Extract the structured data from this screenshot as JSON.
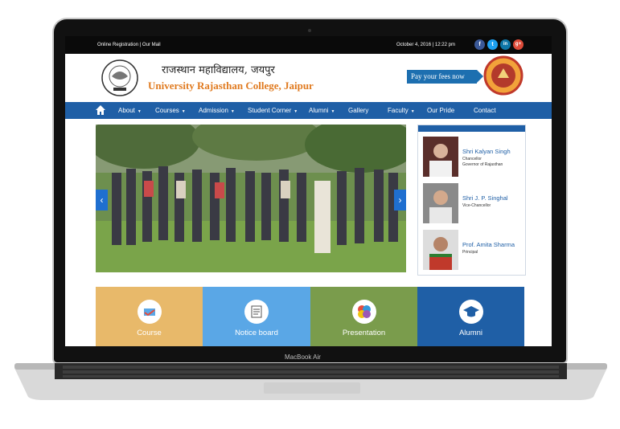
{
  "topbar": {
    "links": "Online Registration | Our Mail",
    "datetime": "October 4, 2016 | 12:22 pm",
    "social": [
      {
        "icon": "facebook-icon",
        "glyph": "f",
        "color": "#3b5998"
      },
      {
        "icon": "twitter-icon",
        "glyph": "t",
        "color": "#1da1f2"
      },
      {
        "icon": "linkedin-icon",
        "glyph": "in",
        "color": "#0e76a8"
      },
      {
        "icon": "google-plus-icon",
        "glyph": "g+",
        "color": "#dd4b39"
      }
    ]
  },
  "header": {
    "hindi_title": "राजस्थान महाविद्यालय, जयपुर",
    "english_title": "University Rajasthan College, Jaipur",
    "pay_fees": "Pay your fees now",
    "seal_text": "Established - 1957",
    "seal_motto": "कर्मो मे कौशलम"
  },
  "nav": {
    "items": [
      {
        "label": "About",
        "dropdown": true
      },
      {
        "label": "Courses",
        "dropdown": true
      },
      {
        "label": "Admission",
        "dropdown": true
      },
      {
        "label": "Student Corner",
        "dropdown": true
      },
      {
        "label": "Alumni",
        "dropdown": true
      },
      {
        "label": "Gallery",
        "dropdown": false
      },
      {
        "label": "Faculty",
        "dropdown": true
      },
      {
        "label": "Our Pride",
        "dropdown": false
      },
      {
        "label": "Contact",
        "dropdown": false
      }
    ],
    "color": "#1f5fa6"
  },
  "people": [
    {
      "name": "Shri Kalyan Singh",
      "role1": "Chancellor",
      "role2": "Governor of Rajasthan"
    },
    {
      "name": "Shri J. P. Singhal",
      "role1": "Vice-Chancellor",
      "role2": ""
    },
    {
      "name": "Prof. Amita Sharma",
      "role1": "Principal",
      "role2": ""
    }
  ],
  "tiles": [
    {
      "label": "Course",
      "color": "#e8b96a",
      "icon": "course-icon"
    },
    {
      "label": "Notice board",
      "color": "#5aa7e6",
      "icon": "notice-board-icon"
    },
    {
      "label": "Presentation",
      "color": "#7a9c4c",
      "icon": "presentation-icon"
    },
    {
      "label": "Alumni",
      "color": "#1f5fa6",
      "icon": "graduation-cap-icon"
    }
  ],
  "laptop": {
    "brand": "MacBook Air"
  }
}
